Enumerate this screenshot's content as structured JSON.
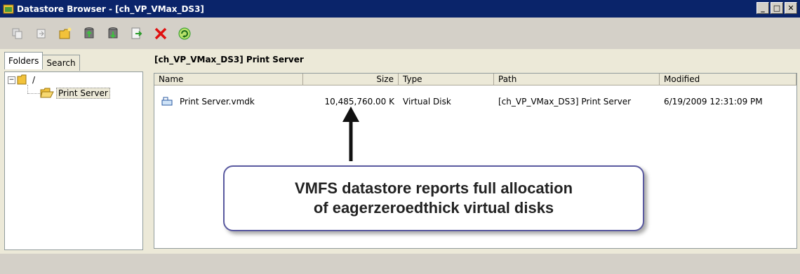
{
  "window": {
    "title": "Datastore Browser - [ch_VP_VMax_DS3]",
    "controls": [
      "_",
      "□",
      "✕"
    ]
  },
  "toolbar": {
    "icons": [
      "copy-icon",
      "move-icon",
      "new-folder-icon",
      "upload-icon",
      "download-icon",
      "register-vm-icon",
      "delete-icon",
      "refresh-icon"
    ]
  },
  "tabs": {
    "folders": "Folders",
    "search": "Search"
  },
  "tree": {
    "root": "/",
    "child": "Print Server"
  },
  "content": {
    "header": "[ch_VP_VMax_DS3] Print Server",
    "columns": {
      "name": "Name",
      "size": "Size",
      "type": "Type",
      "path": "Path",
      "modified": "Modified"
    },
    "rows": [
      {
        "name": "Print Server.vmdk",
        "size": "10,485,760.00 K",
        "type": "Virtual Disk",
        "path": "[ch_VP_VMax_DS3] Print Server",
        "modified": "6/19/2009 12:31:09 PM"
      }
    ]
  },
  "callout": {
    "line1": "VMFS datastore reports full allocation",
    "line2": "of eagerzeroedthick virtual disks"
  },
  "colors": {
    "titlebar": "#0a246a",
    "callout_border": "#5a5aa0",
    "delete_red": "#e01010",
    "refresh_green": "#2a9a2a",
    "folder_yellow": "#f2c23a"
  }
}
